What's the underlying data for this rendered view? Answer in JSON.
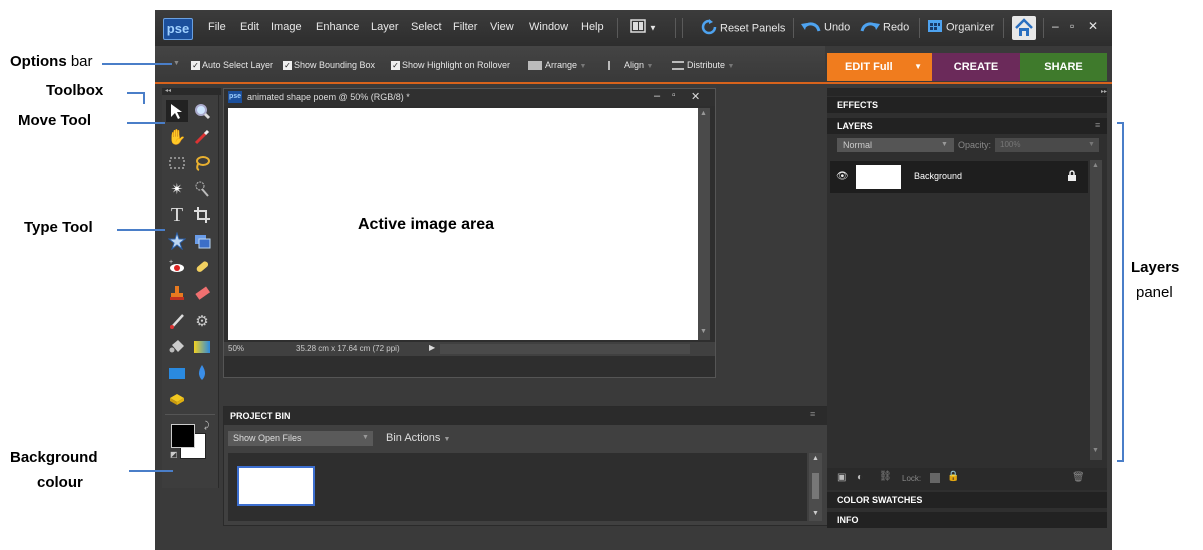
{
  "menubar": {
    "logo": "pse",
    "items": [
      "File",
      "Edit",
      "Image",
      "Enhance",
      "Layer",
      "Select",
      "Filter",
      "View",
      "Window",
      "Help"
    ],
    "reset_panels": "Reset Panels",
    "undo": "Undo",
    "redo": "Redo",
    "organizer": "Organizer",
    "window_controls": [
      "–",
      "▫",
      "✕"
    ]
  },
  "options_bar": {
    "auto_select_layer": "Auto Select Layer",
    "show_bounding_box": "Show Bounding Box",
    "show_highlight": "Show Highlight on Rollover",
    "arrange": "Arrange",
    "align": "Align",
    "distribute": "Distribute"
  },
  "edit_tabs": {
    "edit_full": "EDIT Full",
    "create": "CREATE",
    "share": "SHARE"
  },
  "document": {
    "badge": "pse",
    "title": "animated shape poem @ 50% (RGB/8) *",
    "zoom": "50%",
    "size_info": "35.28 cm x 17.64 cm (72 ppi)"
  },
  "project_bin": {
    "title": "PROJECT BIN",
    "dropdown": "Show Open Files",
    "bin_actions": "Bin Actions"
  },
  "panels": {
    "effects": "EFFECTS",
    "layers": "LAYERS",
    "blend_mode": "Normal",
    "opacity_label": "Opacity:",
    "opacity_value": "100%",
    "layer_name": "Background",
    "lock_label": "Lock:",
    "color_swatches": "COLOR SWATCHES",
    "info": "INFO"
  },
  "annotations": {
    "options_bold": "Options",
    "options_rest": " bar",
    "toolbox": "Toolbox",
    "move_tool": "Move Tool",
    "type_tool": "Type Tool",
    "background_line1": "Background",
    "background_line2": "colour",
    "active_image_area": "Active image area",
    "layers_bold": "Layers",
    "layers_rest": "panel"
  },
  "colors": {
    "accent_orange": "#f07c1e",
    "create_purple": "#6b2a5a",
    "share_green": "#3f7a2c",
    "leader_blue": "#4a7ec8"
  }
}
